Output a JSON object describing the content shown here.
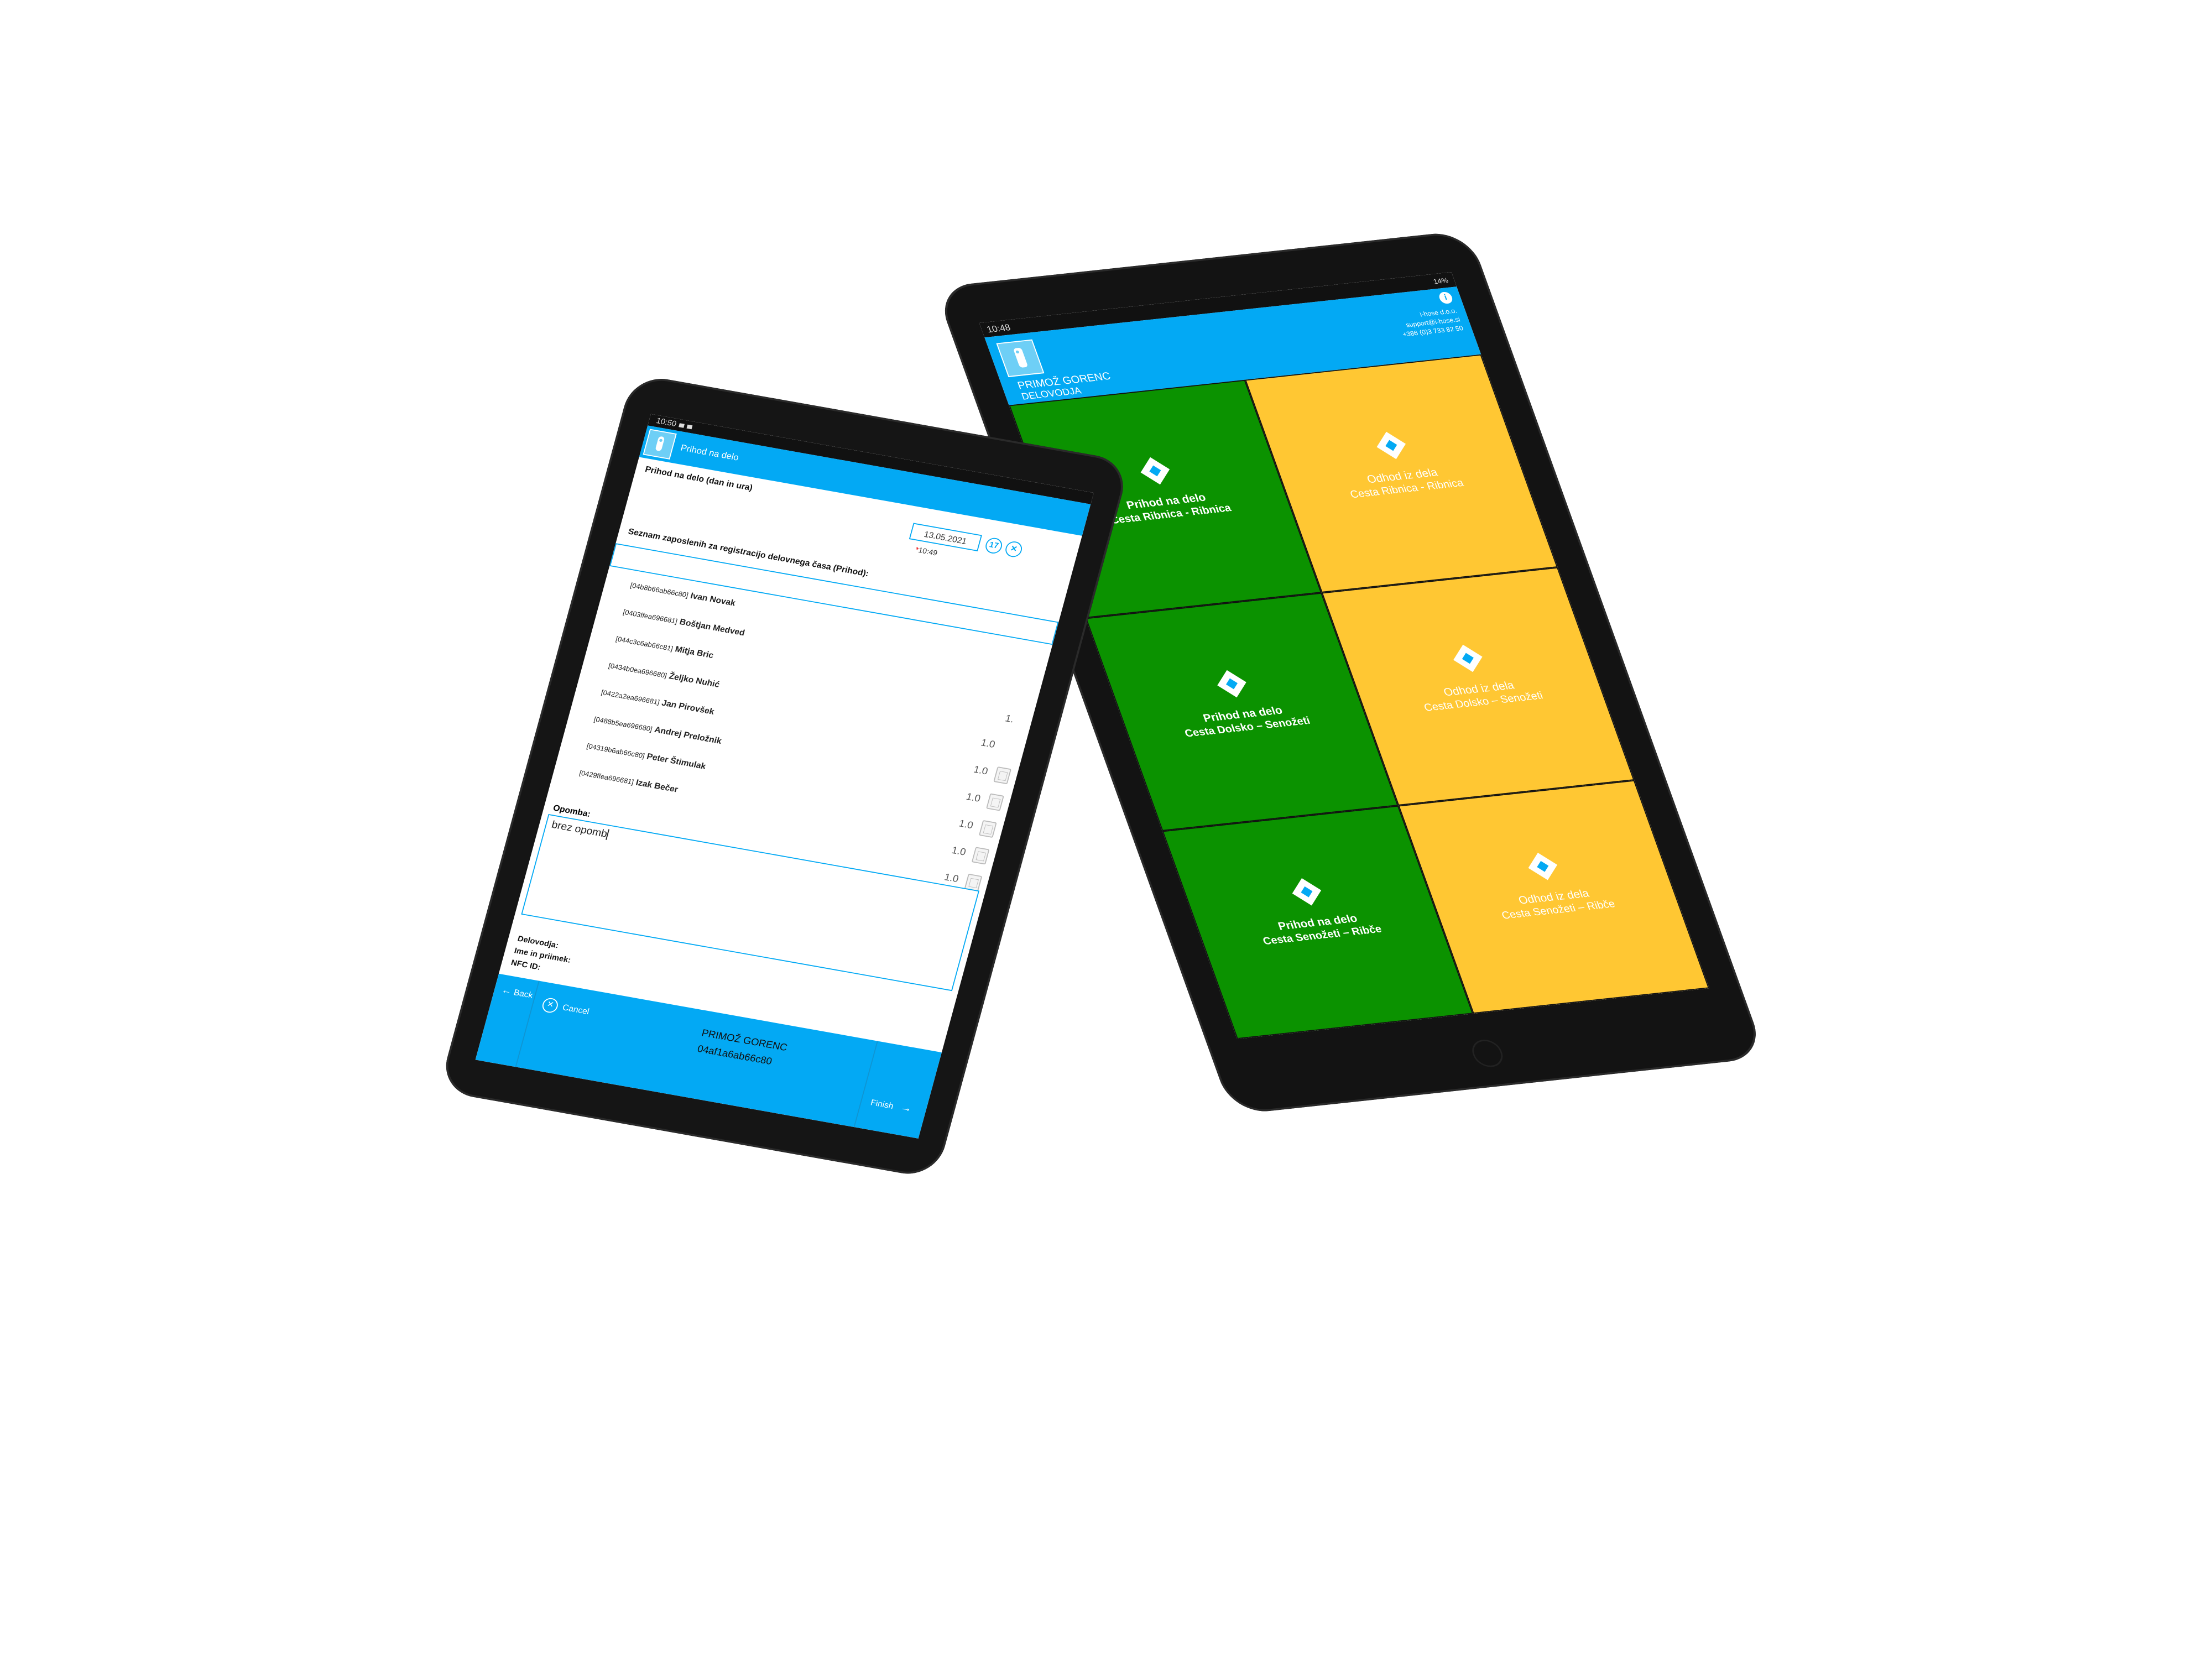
{
  "tablet_left": {
    "status_time": "10:50",
    "header_title": "Prihod na delo",
    "datetime_label": "Prihod na delo (dan in ura)",
    "date_value": "13.05.2021",
    "calendar_icon": "calendar-icon",
    "clear_icon": "clear-icon",
    "time_star": "*",
    "time_value": "10:49",
    "employees_label": "Seznam zaposlenih za registracijo delovnega časa (Prihod):",
    "employees": [
      {
        "id": "[04b8b66ab66c80]",
        "name": "Ivan Novak"
      },
      {
        "id": "[0403ffea696681]",
        "name": "Boštjan Medved"
      },
      {
        "id": "[044c3c6ab66c81]",
        "name": "Mitja Bric"
      },
      {
        "id": "[0434b0ea696680]",
        "name": "Željko Nuhić"
      },
      {
        "id": "[0422a2ea696681]",
        "name": "Jan Pirovšek"
      },
      {
        "id": "[0488b5ea696680]",
        "name": "Andrej Preložnik"
      },
      {
        "id": "[04319b6ab66c80]",
        "name": "Peter Štimulak"
      },
      {
        "id": "[0429ffea696681]",
        "name": "Izak Bečer"
      }
    ],
    "hour_values": [
      "1.",
      "1.0",
      "1.0",
      "1.0",
      "1.0",
      "1.0",
      "1.0"
    ],
    "note_label": "Opomba:",
    "note_value": "brez opomb",
    "manager_label": "Delovodja:",
    "fullname_label": "Ime in priimek:",
    "nfc_label": "NFC ID:",
    "manager_name": "PRIMOŽ GORENC",
    "manager_nfc": "04af1a6ab66c80",
    "back_label": "Back",
    "cancel_label": "Cancel",
    "finish_label": "Finish"
  },
  "tablet_right": {
    "status_time": "10:48",
    "status_right": "14%",
    "worker_name": "PRIMOŽ GORENC",
    "worker_role": "DELOVODJA",
    "company_name": "i-hose d.o.o.",
    "company_email": "support@i-hose.si",
    "company_phone": "+386 (0)3 733 82 50",
    "info_icon": "info-icon",
    "tiles": [
      {
        "l1": "Prihod na delo",
        "l2": "Cesta Ribnica - Ribnica",
        "color": "#0b9200"
      },
      {
        "l1": "Odhod iz dela",
        "l2": "Cesta Ribnica - Ribnica",
        "color": "#ffc733"
      },
      {
        "l1": "Prihod na delo",
        "l2": "Cesta Dolsko – Senožeti",
        "color": "#0b9200"
      },
      {
        "l1": "Odhod iz dela",
        "l2": "Cesta Dolsko – Senožeti",
        "color": "#ffc733"
      },
      {
        "l1": "Prihod na delo",
        "l2": "Cesta Senožeti – Ribče",
        "color": "#0b9200"
      },
      {
        "l1": "Odhod iz dela",
        "l2": "Cesta Senožeti – Ribče",
        "color": "#ffc733"
      }
    ]
  },
  "colors": {
    "accent": "#03a9f4",
    "arrival": "#0b9200",
    "departure": "#ffc733",
    "bezel": "#151515"
  }
}
